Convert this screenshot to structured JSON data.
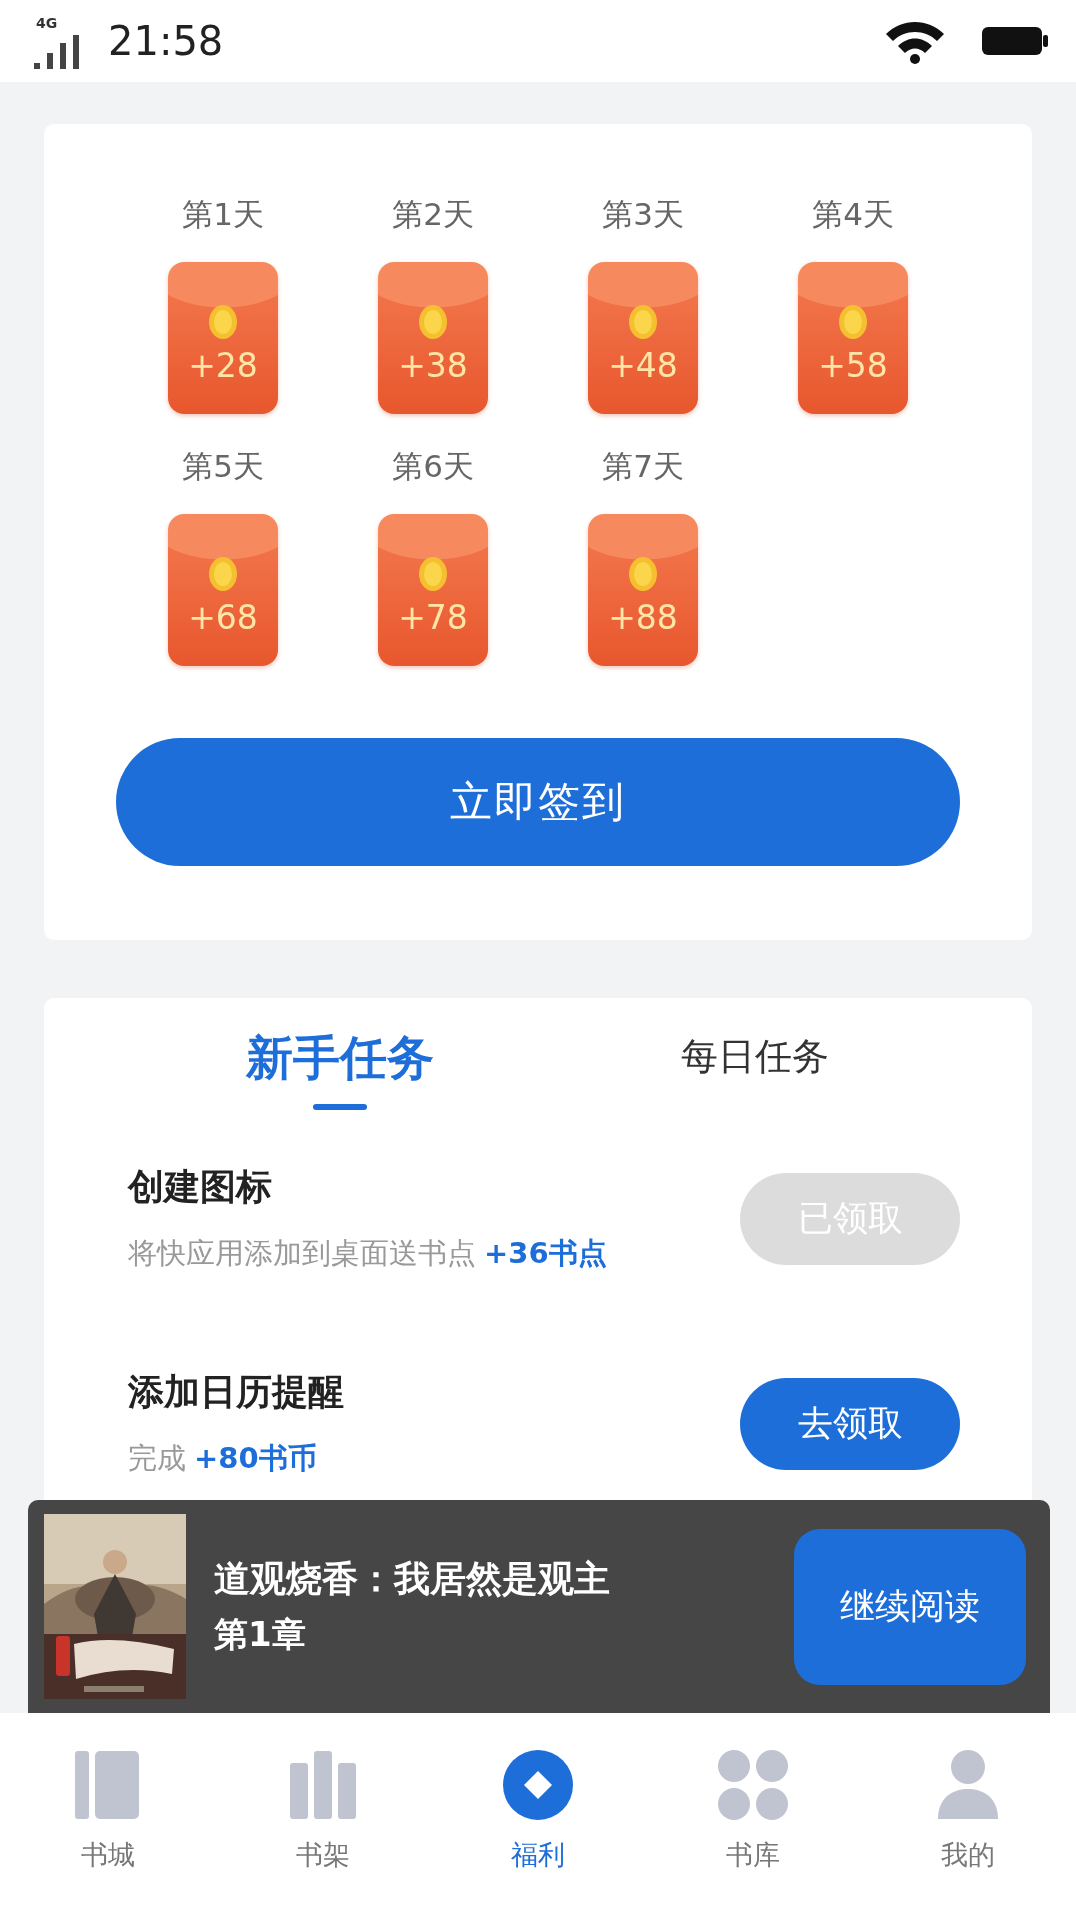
{
  "status_bar": {
    "network": "4G",
    "time": "21:58"
  },
  "checkin": {
    "days": [
      {
        "label": "第1天",
        "amount": "+28"
      },
      {
        "label": "第2天",
        "amount": "+38"
      },
      {
        "label": "第3天",
        "amount": "+48"
      },
      {
        "label": "第4天",
        "amount": "+58"
      },
      {
        "label": "第5天",
        "amount": "+68"
      },
      {
        "label": "第6天",
        "amount": "+78"
      },
      {
        "label": "第7天",
        "amount": "+88"
      }
    ],
    "button": "立即签到"
  },
  "tasks": {
    "tabs": [
      {
        "label": "新手任务",
        "selected": true
      },
      {
        "label": "每日任务",
        "selected": false
      }
    ],
    "items": [
      {
        "title": "创建图标",
        "desc": "将快应用添加到桌面送书点",
        "reward": "+36书点",
        "button": {
          "label": "已领取",
          "kind": "done"
        }
      },
      {
        "title": "添加日历提醒",
        "desc": "完成",
        "reward": "+80书币",
        "button": {
          "label": "去领取",
          "kind": "claim"
        }
      }
    ]
  },
  "reading_bar": {
    "book_title": "道观烧香：我居然是观主",
    "chapter": "第1章",
    "button": "继续阅读"
  },
  "tab_bar": [
    {
      "label": "书城",
      "kind": "columns",
      "selected": false
    },
    {
      "label": "书架",
      "kind": "shelf",
      "selected": false
    },
    {
      "label": "福利",
      "kind": "diamond",
      "selected": true
    },
    {
      "label": "书库",
      "kind": "grid",
      "selected": false
    },
    {
      "label": "我的",
      "kind": "person",
      "selected": false
    }
  ]
}
